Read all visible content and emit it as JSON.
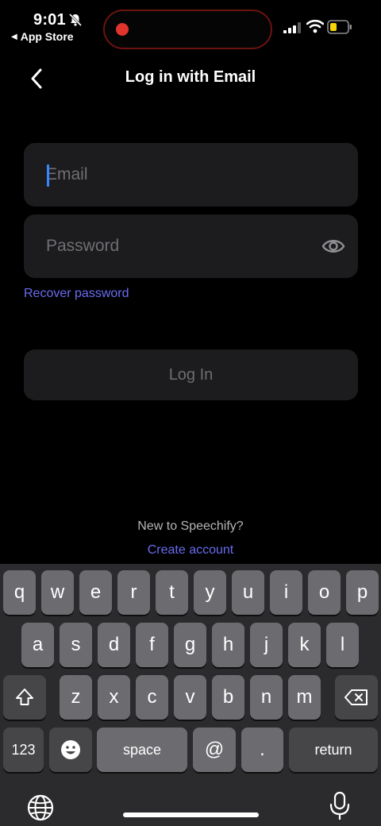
{
  "status": {
    "time": "9:01",
    "back_app": "App Store",
    "icons": [
      "bell-slash-icon",
      "recording-dot-icon",
      "cellular-signal-icon",
      "wifi-icon",
      "battery-icon"
    ]
  },
  "nav": {
    "title": "Log in with Email",
    "back_icon": "chevron-left-icon"
  },
  "form": {
    "email_placeholder": "Email",
    "email_value": "",
    "password_placeholder": "Password",
    "password_value": "",
    "password_toggle_icon": "eye-icon",
    "recover_label": "Recover password",
    "login_label": "Log In"
  },
  "footer": {
    "new_to": "New to Speechify?",
    "create_label": "Create account"
  },
  "keyboard": {
    "row1": [
      "q",
      "w",
      "e",
      "r",
      "t",
      "y",
      "u",
      "i",
      "o",
      "p"
    ],
    "row2": [
      "a",
      "s",
      "d",
      "f",
      "g",
      "h",
      "j",
      "k",
      "l"
    ],
    "row3": [
      "z",
      "x",
      "c",
      "v",
      "b",
      "n",
      "m"
    ],
    "numbers_label": "123",
    "space_label": "space",
    "at_label": "@",
    "dot_label": ".",
    "return_label": "return",
    "icons": [
      "shift-icon",
      "backspace-icon",
      "emoji-icon",
      "globe-icon",
      "microphone-icon"
    ]
  },
  "colors": {
    "accent": "#6a6cf0",
    "caret": "#3a86ff",
    "recording": "#e0342d",
    "battery": "#f5d50a"
  }
}
